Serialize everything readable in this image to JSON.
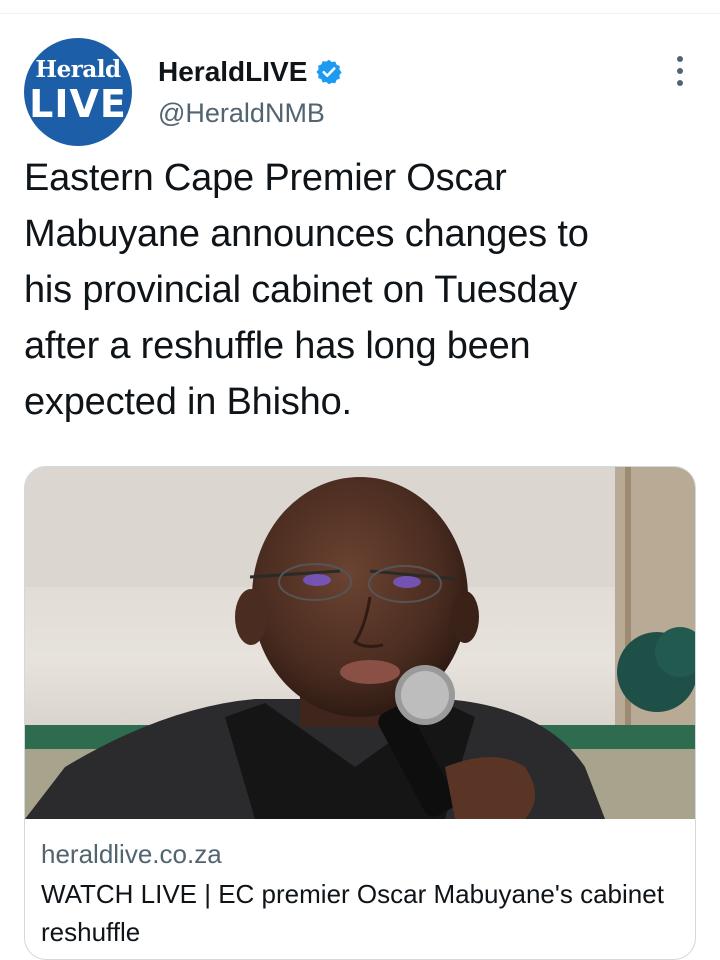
{
  "account": {
    "avatar_line1": "Herald",
    "avatar_line2": "LIVE",
    "display_name": "HeraldLIVE",
    "handle": "@HeraldNMB",
    "verified": true,
    "verified_icon": "verified-badge-icon",
    "accent_color": "#1d9bf0",
    "avatar_color": "#1d5ea8"
  },
  "more_menu": {
    "icon": "more-vertical-icon"
  },
  "tweet": {
    "text": "Eastern Cape Premier Oscar\nMabuyane announces changes to\nhis provincial cabinet on Tuesday\nafter a reshuffle has long been\nexpected in Bhisho."
  },
  "link_card": {
    "domain": "heraldlive.co.za",
    "title": "WATCH LIVE | EC premier Oscar Mabuyane's cabinet reshuffle"
  }
}
